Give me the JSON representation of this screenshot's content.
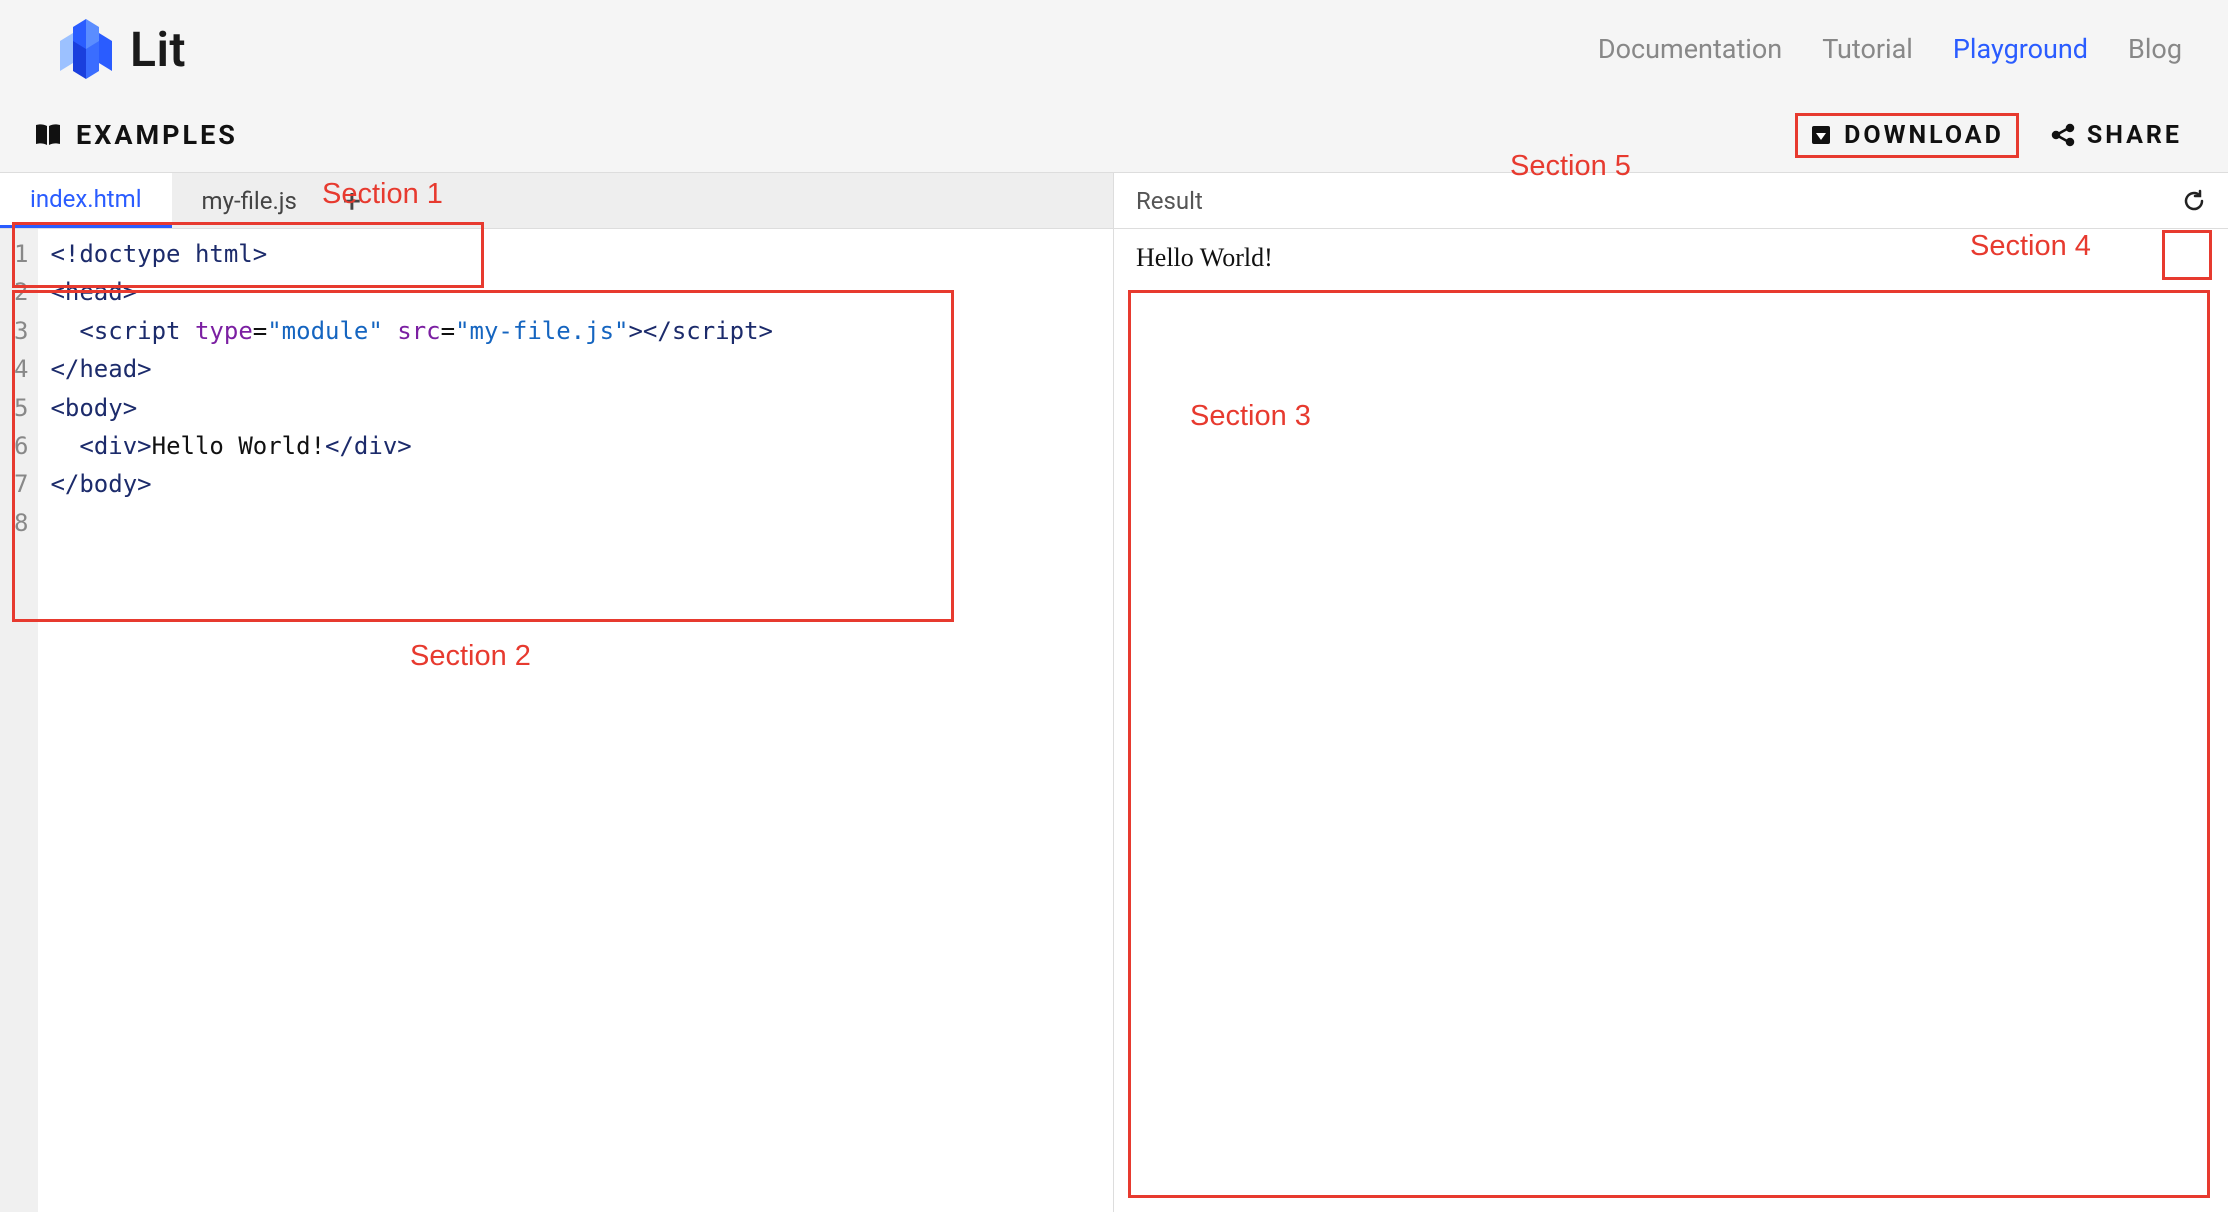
{
  "brand": {
    "name": "Lit"
  },
  "nav": {
    "items": [
      {
        "label": "Documentation",
        "active": false
      },
      {
        "label": "Tutorial",
        "active": false
      },
      {
        "label": "Playground",
        "active": true
      },
      {
        "label": "Blog",
        "active": false
      }
    ]
  },
  "toolbar": {
    "examples_label": "EXAMPLES",
    "download_label": "DOWNLOAD",
    "share_label": "SHARE"
  },
  "tabs": {
    "items": [
      {
        "label": "index.html",
        "active": true
      },
      {
        "label": "my-file.js",
        "active": false
      }
    ]
  },
  "editor": {
    "line_count": 8,
    "lines": {
      "l1": {
        "doctype": "<!doctype html>"
      },
      "l2": {
        "open1": "<",
        "tag": "head",
        "open2": ">"
      },
      "l3": {
        "indent": "  ",
        "open1": "<",
        "tag": "script",
        "sp": " ",
        "attr1": "type",
        "eq1": "=",
        "val1": "\"module\"",
        "sp2": " ",
        "attr2": "src",
        "eq2": "=",
        "val2": "\"my-file.js\"",
        "open2": ">",
        "close1": "</",
        "ctag": "script",
        "close2": ">"
      },
      "l4": {
        "close1": "</",
        "tag": "head",
        "close2": ">"
      },
      "l5": {
        "open1": "<",
        "tag": "body",
        "open2": ">"
      },
      "l6": {
        "indent": "  ",
        "open1": "<",
        "tag": "div",
        "open2": ">",
        "text": "Hello World!",
        "close1": "</",
        "ctag": "div",
        "close2": ">"
      },
      "l7": {
        "close1": "</",
        "tag": "body",
        "close2": ">"
      },
      "l8": {
        "empty": ""
      }
    }
  },
  "result": {
    "header": "Result",
    "output": "Hello World!"
  },
  "annotations": {
    "s1": "Section 1",
    "s2": "Section 2",
    "s3": "Section 3",
    "s4": "Section 4",
    "s5": "Section 5"
  }
}
